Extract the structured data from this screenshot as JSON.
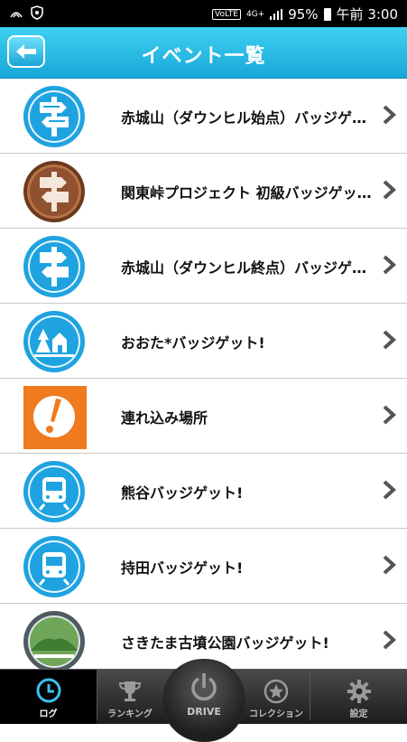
{
  "status_bar": {
    "left_icons": [
      "nfc-icon",
      "shield-icon"
    ],
    "volte": "VoLTE",
    "network": "4G+",
    "battery_percent": "95%",
    "time": "午前 3:00"
  },
  "header": {
    "title": "イベント一覧",
    "back_icon": "back-arrow-icon"
  },
  "events": [
    {
      "label": "赤城山（ダウンヒル始点）バッジゲット！",
      "icon": "road-sign-badge-icon",
      "badge_color": "#1fa3e0"
    },
    {
      "label": "関東峠プロジェクト 初級バッジゲット！",
      "icon": "road-sign-bronze-badge-icon",
      "badge_color": "#9a5a35"
    },
    {
      "label": "赤城山（ダウンヒル終点）バッジゲット！",
      "icon": "road-sign-badge-icon",
      "badge_color": "#1fa3e0"
    },
    {
      "label": "おおた*バッジゲット!",
      "icon": "park-badge-icon",
      "badge_color": "#1fa3e0"
    },
    {
      "label": "連れ込み場所",
      "icon": "exclamation-icon",
      "badge_color": "#f07a1e"
    },
    {
      "label": "熊谷バッジゲット!",
      "icon": "train-badge-icon",
      "badge_color": "#1fa3e0"
    },
    {
      "label": "持田バッジゲット!",
      "icon": "train-badge-icon",
      "badge_color": "#1fa3e0"
    },
    {
      "label": "さきたま古墳公園バッジゲット!",
      "icon": "tumulus-badge-icon",
      "badge_color": "#7c8a94"
    }
  ],
  "tabs": {
    "log": "ログ",
    "ranking": "ランキング",
    "drive": "DRIVE",
    "collection": "コレクション",
    "settings": "設定"
  },
  "colors": {
    "header_blue": "#1fb6e6",
    "badge_blue": "#1fa3e0",
    "active_tab_accent": "#3cc0f0"
  }
}
